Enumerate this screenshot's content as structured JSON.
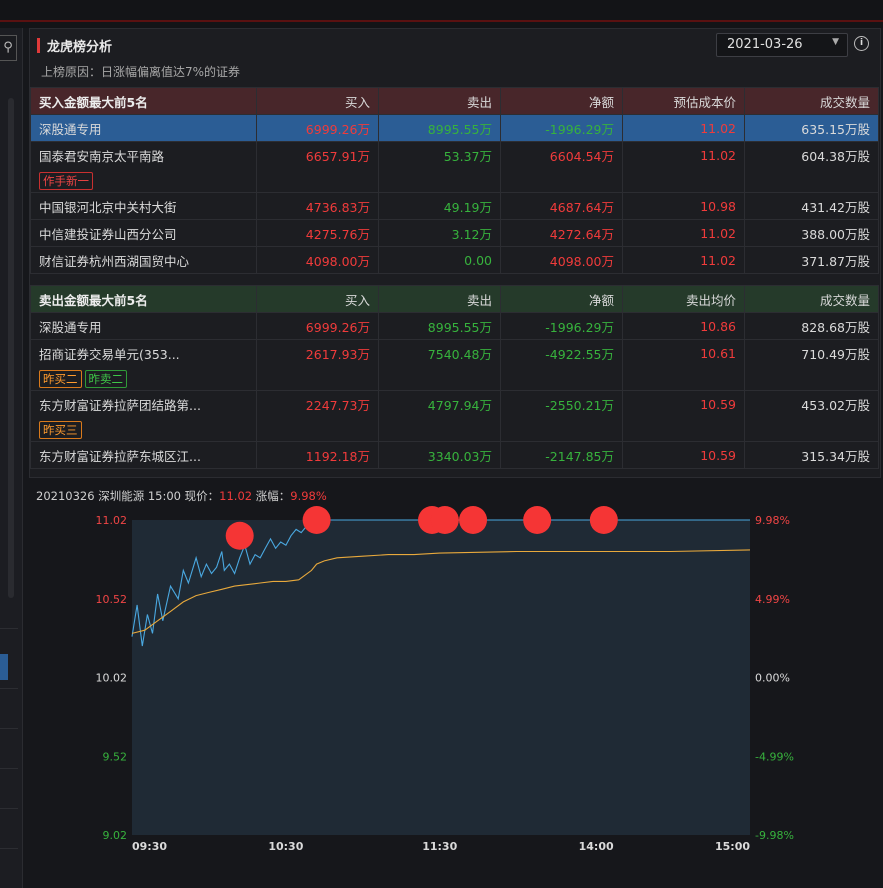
{
  "panel": {
    "title": "龙虎榜分析",
    "date": "2021-03-26",
    "reason": "上榜原因：日涨幅偏离值达7%的证券"
  },
  "buy_table": {
    "headers": [
      "买入金额最大前5名",
      "买入",
      "卖出",
      "净额",
      "预估成本价",
      "成交数量"
    ],
    "rows": [
      {
        "name": "深股通专用",
        "buy": "6999.26万",
        "sell": "8995.55万",
        "net": "-1996.29万",
        "price": "11.02",
        "volume": "635.15万股",
        "tags": []
      },
      {
        "name": "国泰君安南京太平南路",
        "buy": "6657.91万",
        "sell": "53.37万",
        "net": "6604.54万",
        "price": "11.02",
        "volume": "604.38万股",
        "tags": [
          {
            "text": "作手新一",
            "color": "red"
          }
        ]
      },
      {
        "name": "中国银河北京中关村大街",
        "buy": "4736.83万",
        "sell": "49.19万",
        "net": "4687.64万",
        "price": "10.98",
        "volume": "431.42万股",
        "tags": []
      },
      {
        "name": "中信建投证券山西分公司",
        "buy": "4275.76万",
        "sell": "3.12万",
        "net": "4272.64万",
        "price": "11.02",
        "volume": "388.00万股",
        "tags": []
      },
      {
        "name": "财信证券杭州西湖国贸中心",
        "buy": "4098.00万",
        "sell": "0.00",
        "net": "4098.00万",
        "price": "11.02",
        "volume": "371.87万股",
        "tags": []
      }
    ]
  },
  "sell_table": {
    "headers": [
      "卖出金额最大前5名",
      "买入",
      "卖出",
      "净额",
      "卖出均价",
      "成交数量"
    ],
    "rows": [
      {
        "name": "深股通专用",
        "buy": "6999.26万",
        "sell": "8995.55万",
        "net": "-1996.29万",
        "price": "10.86",
        "volume": "828.68万股",
        "tags": []
      },
      {
        "name": "招商证券交易单元(353...",
        "buy": "2617.93万",
        "sell": "7540.48万",
        "net": "-4922.55万",
        "price": "10.61",
        "volume": "710.49万股",
        "tags": [
          {
            "text": "昨买二",
            "color": "org"
          },
          {
            "text": "昨卖二",
            "color": "grn"
          }
        ]
      },
      {
        "name": "东方财富证券拉萨团结路第...",
        "buy": "2247.73万",
        "sell": "4797.94万",
        "net": "-2550.21万",
        "price": "10.59",
        "volume": "453.02万股",
        "tags": [
          {
            "text": "昨买三",
            "color": "org"
          }
        ]
      },
      {
        "name": "东方财富证券拉萨东城区江...",
        "buy": "1192.18万",
        "sell": "3340.03万",
        "net": "-2147.85万",
        "price": "10.59",
        "volume": "315.34万股",
        "tags": []
      }
    ]
  },
  "chart_header": {
    "date": "20210326",
    "name": "深圳能源",
    "time": "15:00",
    "price_label": "现价：",
    "price": "11.02",
    "change_label": "涨幅：",
    "change": "9.98%"
  },
  "chart_data": {
    "type": "line",
    "x_ticks": [
      "09:30",
      "10:30",
      "11:30",
      "14:00",
      "15:00"
    ],
    "y_left_ticks": [
      "11.02",
      "10.52",
      "10.02",
      "9.52",
      "9.02"
    ],
    "y_right_ticks": [
      "9.98%",
      "4.99%",
      "0.00%",
      "-4.99%",
      "-9.98%"
    ],
    "ylim": [
      9.02,
      11.02
    ],
    "prev_close": 10.02,
    "series": [
      {
        "color": "#4aa8e0",
        "points": [
          [
            0,
            10.28
          ],
          [
            2,
            10.48
          ],
          [
            4,
            10.22
          ],
          [
            6,
            10.42
          ],
          [
            8,
            10.3
          ],
          [
            10,
            10.55
          ],
          [
            12,
            10.38
          ],
          [
            15,
            10.6
          ],
          [
            18,
            10.52
          ],
          [
            20,
            10.7
          ],
          [
            22,
            10.62
          ],
          [
            25,
            10.78
          ],
          [
            27,
            10.66
          ],
          [
            29,
            10.74
          ],
          [
            31,
            10.68
          ],
          [
            33,
            10.72
          ],
          [
            35,
            10.82
          ],
          [
            36,
            10.7
          ],
          [
            38,
            10.74
          ],
          [
            40,
            10.68
          ],
          [
            42,
            10.78
          ],
          [
            44,
            10.86
          ],
          [
            46,
            10.74
          ],
          [
            48,
            10.8
          ],
          [
            50,
            10.78
          ],
          [
            52,
            10.84
          ],
          [
            54,
            10.9
          ],
          [
            56,
            10.84
          ],
          [
            58,
            10.88
          ],
          [
            60,
            10.86
          ],
          [
            62,
            10.92
          ],
          [
            64,
            10.96
          ],
          [
            66,
            10.94
          ],
          [
            68,
            10.98
          ],
          [
            69,
            11.02
          ],
          [
            80,
            11.02
          ],
          [
            120,
            11.02
          ],
          [
            241,
            11.02
          ]
        ]
      },
      {
        "color": "#e8a93c",
        "points": [
          [
            0,
            10.3
          ],
          [
            5,
            10.32
          ],
          [
            10,
            10.38
          ],
          [
            15,
            10.44
          ],
          [
            20,
            10.5
          ],
          [
            25,
            10.54
          ],
          [
            30,
            10.56
          ],
          [
            35,
            10.58
          ],
          [
            40,
            10.6
          ],
          [
            45,
            10.61
          ],
          [
            50,
            10.62
          ],
          [
            55,
            10.63
          ],
          [
            60,
            10.63
          ],
          [
            65,
            10.64
          ],
          [
            70,
            10.7
          ],
          [
            72,
            10.74
          ],
          [
            75,
            10.76
          ],
          [
            80,
            10.78
          ],
          [
            90,
            10.79
          ],
          [
            100,
            10.8
          ],
          [
            110,
            10.8
          ],
          [
            120,
            10.81
          ],
          [
            150,
            10.82
          ],
          [
            180,
            10.82
          ],
          [
            210,
            10.82
          ],
          [
            241,
            10.83
          ]
        ]
      }
    ],
    "markers": [
      [
        42,
        10.92
      ],
      [
        72,
        11.02
      ],
      [
        117,
        11.02
      ],
      [
        122,
        11.02
      ],
      [
        133,
        11.02
      ],
      [
        158,
        11.02
      ],
      [
        184,
        11.02
      ]
    ]
  }
}
